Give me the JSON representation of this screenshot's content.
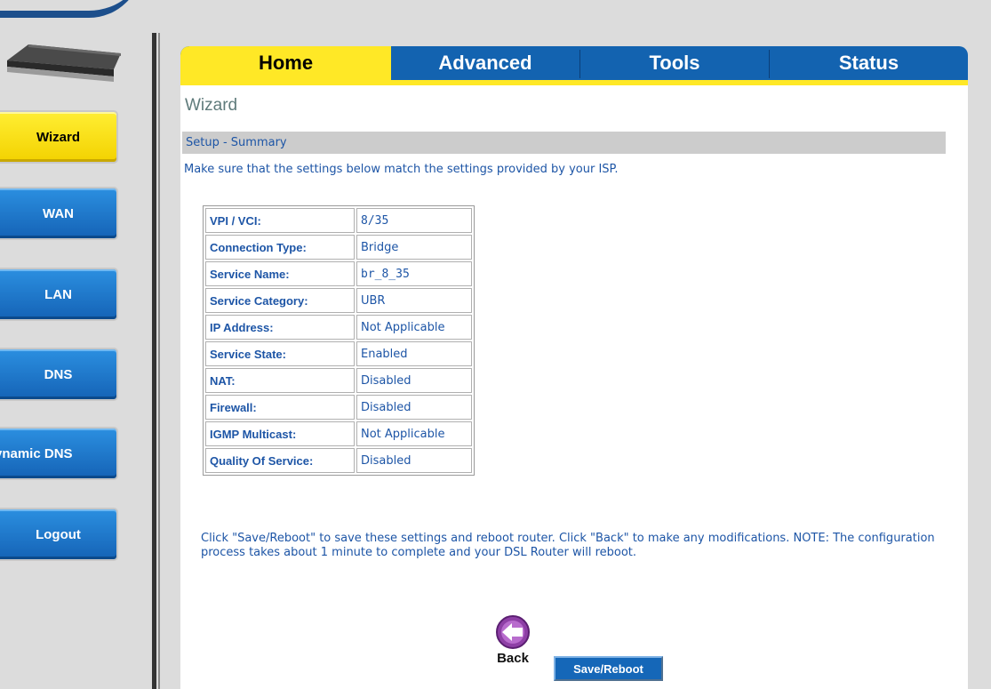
{
  "sidebar": {
    "items": [
      {
        "label": "Wizard",
        "active": true
      },
      {
        "label": "WAN"
      },
      {
        "label": "LAN"
      },
      {
        "label": "DNS"
      },
      {
        "label": "ynamic DNS"
      },
      {
        "label": "Logout"
      }
    ]
  },
  "tabs": [
    {
      "label": "Home",
      "active": true
    },
    {
      "label": "Advanced"
    },
    {
      "label": "Tools"
    },
    {
      "label": "Status"
    }
  ],
  "page": {
    "title": "Wizard",
    "section": "Setup - Summary",
    "intro": "Make sure that the settings below match the settings provided by your ISP."
  },
  "summary": {
    "rows": [
      {
        "key": "VPI / VCI:",
        "value": "8/35"
      },
      {
        "key": "Connection Type:",
        "value": "Bridge"
      },
      {
        "key": "Service Name:",
        "value": "br_8_35"
      },
      {
        "key": "Service Category:",
        "value": "UBR"
      },
      {
        "key": "IP Address:",
        "value": "Not Applicable"
      },
      {
        "key": "Service State:",
        "value": "Enabled"
      },
      {
        "key": "NAT:",
        "value": "Disabled"
      },
      {
        "key": "Firewall:",
        "value": "Disabled"
      },
      {
        "key": "IGMP Multicast:",
        "value": "Not Applicable"
      },
      {
        "key": "Quality Of Service:",
        "value": "Disabled"
      }
    ]
  },
  "note": "Click \"Save/Reboot\" to save these settings and reboot router. Click \"Back\" to make any modifications. NOTE: The configuration process takes about 1 minute to complete and your DSL Router will reboot.",
  "buttons": {
    "back": "Back",
    "save": "Save/Reboot"
  },
  "icons": {
    "back": "back-arrow-icon",
    "router": "router-icon"
  },
  "colors": {
    "tab_blue": "#1363b0",
    "tab_active": "#ffe826",
    "link_text": "#1d55a6",
    "sidebar_button": "#1d74cc",
    "sidebar_active": "#f7dc0d"
  }
}
